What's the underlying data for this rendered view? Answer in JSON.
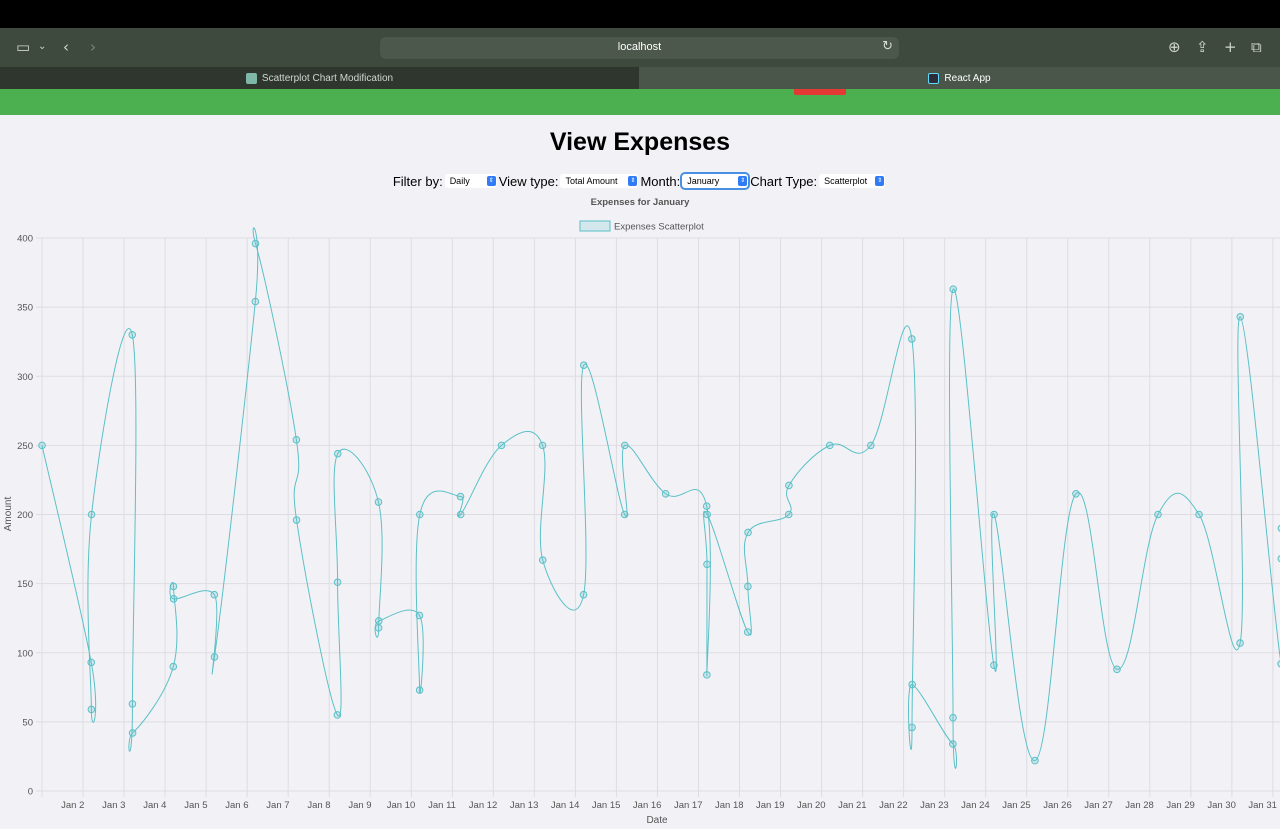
{
  "browser": {
    "url": "localhost",
    "tabs": [
      {
        "label": "Scatterplot Chart Modification",
        "active": false
      },
      {
        "label": "React App",
        "active": true
      }
    ]
  },
  "page": {
    "title": "View Expenses",
    "filters": [
      {
        "label": "Filter by:",
        "value": "Daily"
      },
      {
        "label": "View type:",
        "value": "Total Amount"
      },
      {
        "label": "Month:",
        "value": "January"
      },
      {
        "label": "Chart Type:",
        "value": "Scatterplot"
      }
    ]
  },
  "colors": {
    "nav_green": "#4caf50",
    "logout_red": "#e53935",
    "series": "#5bc0c7"
  },
  "chart_data": {
    "type": "line",
    "title": "Expenses for January",
    "xlabel": "Date",
    "ylabel": "Amount",
    "ylim": [
      0,
      400
    ],
    "yticks": [
      0,
      50,
      100,
      150,
      200,
      250,
      300,
      350,
      400
    ],
    "xticks": [
      "Jan 2",
      "Jan 3",
      "Jan 4",
      "Jan 5",
      "Jan 6",
      "Jan 7",
      "Jan 8",
      "Jan 9",
      "Jan 10",
      "Jan 11",
      "Jan 12",
      "Jan 13",
      "Jan 14",
      "Jan 15",
      "Jan 16",
      "Jan 17",
      "Jan 18",
      "Jan 19",
      "Jan 20",
      "Jan 21",
      "Jan 22",
      "Jan 23",
      "Jan 24",
      "Jan 25",
      "Jan 26",
      "Jan 27",
      "Jan 28",
      "Jan 29",
      "Jan 30",
      "Jan 31"
    ],
    "grid": true,
    "legend_position": "top-center",
    "series": [
      {
        "name": "Expenses Scatterplot",
        "points": [
          [
            "Jan 1",
            250
          ],
          [
            "Jan 2",
            93
          ],
          [
            "Jan 2",
            59
          ],
          [
            "Jan 2",
            200
          ],
          [
            "Jan 3",
            330
          ],
          [
            "Jan 3",
            63
          ],
          [
            "Jan 3",
            42
          ],
          [
            "Jan 4",
            90
          ],
          [
            "Jan 4",
            148
          ],
          [
            "Jan 4",
            139
          ],
          [
            "Jan 5",
            142
          ],
          [
            "Jan 5",
            97
          ],
          [
            "Jan 6",
            354
          ],
          [
            "Jan 6",
            396
          ],
          [
            "Jan 7",
            254
          ],
          [
            "Jan 7",
            196
          ],
          [
            "Jan 8",
            55
          ],
          [
            "Jan 8",
            151
          ],
          [
            "Jan 8",
            244
          ],
          [
            "Jan 9",
            209
          ],
          [
            "Jan 9",
            118
          ],
          [
            "Jan 9",
            123
          ],
          [
            "Jan 10",
            127
          ],
          [
            "Jan 10",
            73
          ],
          [
            "Jan 10",
            200
          ],
          [
            "Jan 11",
            213
          ],
          [
            "Jan 11",
            200
          ],
          [
            "Jan 12",
            250
          ],
          [
            "Jan 13",
            250
          ],
          [
            "Jan 13",
            167
          ],
          [
            "Jan 14",
            142
          ],
          [
            "Jan 14",
            308
          ],
          [
            "Jan 15",
            200
          ],
          [
            "Jan 15",
            250
          ],
          [
            "Jan 16",
            215
          ],
          [
            "Jan 17",
            206
          ],
          [
            "Jan 17",
            84
          ],
          [
            "Jan 17",
            164
          ],
          [
            "Jan 17",
            200
          ],
          [
            "Jan 18",
            115
          ],
          [
            "Jan 18",
            148
          ],
          [
            "Jan 18",
            187
          ],
          [
            "Jan 19",
            200
          ],
          [
            "Jan 19",
            221
          ],
          [
            "Jan 20",
            250
          ],
          [
            "Jan 21",
            250
          ],
          [
            "Jan 22",
            327
          ],
          [
            "Jan 22",
            46
          ],
          [
            "Jan 22",
            77
          ],
          [
            "Jan 23",
            34
          ],
          [
            "Jan 23",
            53
          ],
          [
            "Jan 23",
            363
          ],
          [
            "Jan 24",
            91
          ],
          [
            "Jan 24",
            200
          ],
          [
            "Jan 25",
            22
          ],
          [
            "Jan 26",
            215
          ],
          [
            "Jan 27",
            88
          ],
          [
            "Jan 28",
            200
          ],
          [
            "Jan 29",
            200
          ],
          [
            "Jan 30",
            107
          ],
          [
            "Jan 30",
            343
          ],
          [
            "Jan 31",
            92
          ],
          [
            "Jan 31",
            168
          ],
          [
            "Jan 31",
            190
          ]
        ]
      }
    ]
  }
}
